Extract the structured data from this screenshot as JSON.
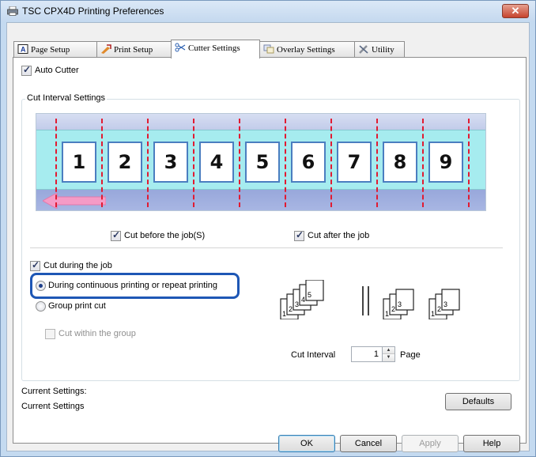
{
  "window": {
    "title": "TSC CPX4D Printing Preferences",
    "close_glyph": "✕"
  },
  "tabs": [
    {
      "label": "Page Setup",
      "icon": "page-setup-icon",
      "active": false
    },
    {
      "label": "Print Setup",
      "icon": "print-setup-icon",
      "active": false
    },
    {
      "label": "Cutter Settings",
      "icon": "scissors-icon",
      "active": true
    },
    {
      "label": "Overlay Settings",
      "icon": "overlay-icon",
      "active": false
    },
    {
      "label": "Utility",
      "icon": "tools-icon",
      "active": false
    }
  ],
  "auto_cutter": {
    "label": "Auto Cutter",
    "checked": true
  },
  "cut_interval_group": {
    "title": "Cut Interval Settings",
    "labels": [
      "1",
      "2",
      "3",
      "4",
      "5",
      "6",
      "7",
      "8",
      "9"
    ],
    "cut_before": {
      "label": "Cut before the job(S)",
      "checked": true
    },
    "cut_after": {
      "label": "Cut after the job",
      "checked": true
    },
    "cut_during": {
      "label": "Cut during the job",
      "checked": true
    },
    "radio_continuous": {
      "label": "During continuous printing or repeat printing",
      "selected": true
    },
    "radio_group": {
      "label": "Group print cut",
      "selected": false
    },
    "cut_within_group": {
      "label": "Cut within the group",
      "checked": false,
      "enabled": false
    },
    "stack_left_numbers": [
      "1",
      "2",
      "3",
      "4",
      "5"
    ],
    "stack_right_numbers": [
      "1",
      "2",
      "3"
    ],
    "cut_interval_label": "Cut Interval",
    "cut_interval_value": "1",
    "page_label": "Page"
  },
  "current_settings": {
    "label": "Current Settings:",
    "value": "Current Settings"
  },
  "buttons": {
    "defaults": "Defaults",
    "ok": "OK",
    "cancel": "Cancel",
    "apply": "Apply",
    "help": "Help"
  },
  "colors": {
    "cut_line": "#e11b32",
    "tape": "#a6ecef",
    "label_border": "#4b7ec0",
    "arrow": "#f49bc6",
    "highlight": "#1e57b5"
  }
}
